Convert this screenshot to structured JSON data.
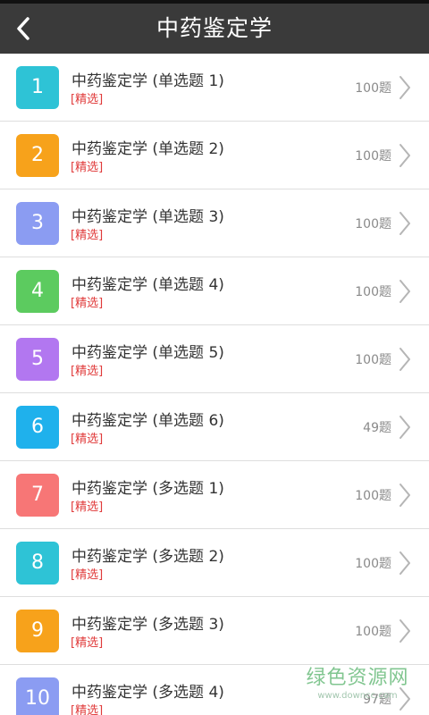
{
  "header": {
    "title": "中药鉴定学"
  },
  "colors": {
    "header_bg": "#3a3a3a",
    "tag_red": "#e03a3a"
  },
  "items": [
    {
      "num": "1",
      "title": "中药鉴定学 (单选题 1)",
      "tag": "[精选]",
      "count": "100题",
      "color": "#2ec3d6"
    },
    {
      "num": "2",
      "title": "中药鉴定学 (单选题 2)",
      "tag": "[精选]",
      "count": "100题",
      "color": "#f7a21b"
    },
    {
      "num": "3",
      "title": "中药鉴定学 (单选题 3)",
      "tag": "[精选]",
      "count": "100题",
      "color": "#8b9cf2"
    },
    {
      "num": "4",
      "title": "中药鉴定学 (单选题 4)",
      "tag": "[精选]",
      "count": "100题",
      "color": "#5ccb5f"
    },
    {
      "num": "5",
      "title": "中药鉴定学 (单选题 5)",
      "tag": "[精选]",
      "count": "100题",
      "color": "#b277f0"
    },
    {
      "num": "6",
      "title": "中药鉴定学 (单选题 6)",
      "tag": "[精选]",
      "count": "49题",
      "color": "#1fb1ec"
    },
    {
      "num": "7",
      "title": "中药鉴定学 (多选题 1)",
      "tag": "[精选]",
      "count": "100题",
      "color": "#f77676"
    },
    {
      "num": "8",
      "title": "中药鉴定学 (多选题 2)",
      "tag": "[精选]",
      "count": "100题",
      "color": "#2ec3d6"
    },
    {
      "num": "9",
      "title": "中药鉴定学 (多选题 3)",
      "tag": "[精选]",
      "count": "100题",
      "color": "#f7a21b"
    },
    {
      "num": "10",
      "title": "中药鉴定学 (多选题 4)",
      "tag": "[精选]",
      "count": "97题",
      "color": "#8b9cf2"
    }
  ],
  "watermark": {
    "main": "绿色资源网",
    "sub": "www.downcc.com"
  }
}
